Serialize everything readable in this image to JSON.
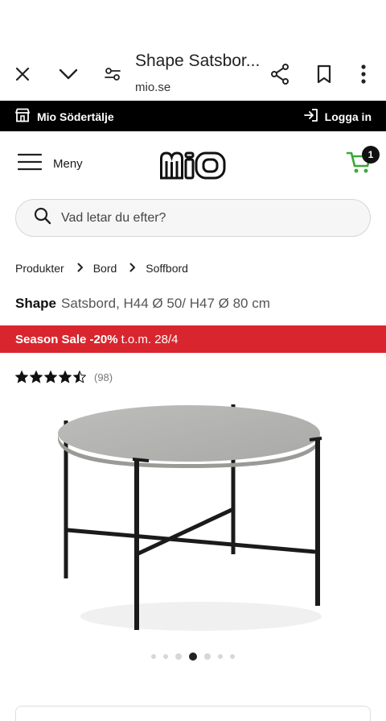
{
  "browser": {
    "page_title": "Shape Satsbor...",
    "domain": "mio.se",
    "icons": [
      "close-icon",
      "chevron-down-icon",
      "page-settings-icon",
      "share-icon",
      "bookmark-icon",
      "more-vert-icon"
    ]
  },
  "storebar": {
    "store_name": "Mio Södertälje",
    "login_label": "Logga in"
  },
  "header": {
    "menu_label": "Meny",
    "logo_text": "mio",
    "cart_count": "1"
  },
  "search": {
    "placeholder": "Vad letar du efter?"
  },
  "breadcrumb": [
    "Produkter",
    "Bord",
    "Soffbord"
  ],
  "product": {
    "brand": "Shape",
    "description": "Satsbord, H44 Ø 50/ H47 Ø 80 cm",
    "rating": 4.5,
    "review_count": "(98)"
  },
  "sale": {
    "label": "Season Sale -20%",
    "until": "t.o.m. 28/4"
  },
  "carousel": {
    "total": 7,
    "active_index": 3
  },
  "colors": {
    "sale_red": "#d9262e",
    "cart_green": "#3aa935",
    "black": "#000000"
  }
}
